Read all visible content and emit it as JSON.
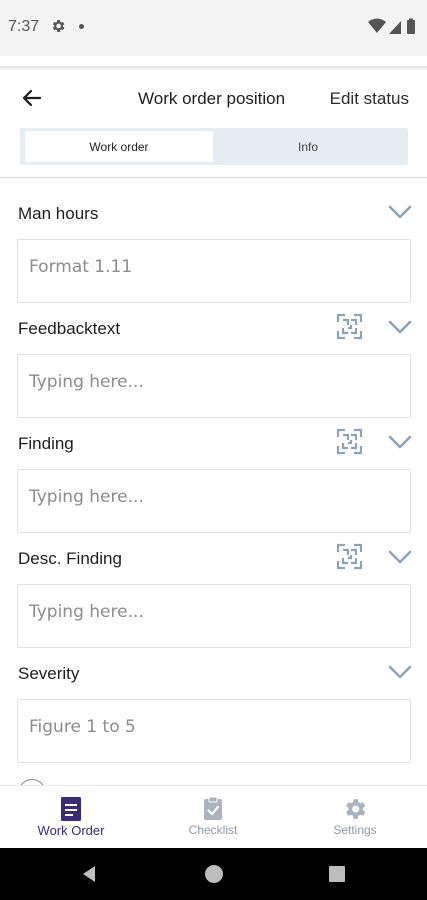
{
  "status_bar": {
    "time": "7:37"
  },
  "header": {
    "title": "Work order position",
    "edit_status_label": "Edit status",
    "tabs": [
      {
        "label": "Work order",
        "active": true
      },
      {
        "label": "Info",
        "active": false
      }
    ]
  },
  "form": {
    "fields": [
      {
        "label": "Man hours",
        "placeholder": "Format 1.11",
        "has_scan": false
      },
      {
        "label": "Feedbacktext",
        "placeholder": "Typing here...",
        "has_scan": true
      },
      {
        "label": "Finding",
        "placeholder": "Typing here...",
        "has_scan": true
      },
      {
        "label": "Desc. Finding",
        "placeholder": "Typing here...",
        "has_scan": true
      },
      {
        "label": "Severity",
        "placeholder": "Figure 1 to 5",
        "has_scan": false
      }
    ]
  },
  "bottom_nav": {
    "items": [
      {
        "label": "Work Order",
        "icon": "work-order-icon",
        "active": true
      },
      {
        "label": "Checklist",
        "icon": "checklist-icon",
        "active": false
      },
      {
        "label": "Settings",
        "icon": "settings-gear-icon",
        "active": false
      }
    ]
  },
  "colors": {
    "accent": "#3b2a75",
    "chevron": "#8ea3b6",
    "segmented_bg": "#e6edf2",
    "inactive_nav": "#a9b4c0"
  }
}
